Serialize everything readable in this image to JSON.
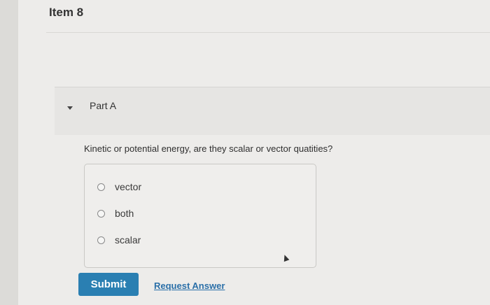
{
  "item": {
    "title": "Item 8"
  },
  "part": {
    "label": "Part A"
  },
  "question": {
    "text": "Kinetic or potential energy, are they scalar or vector quatities?",
    "options": [
      "vector",
      "both",
      "scalar"
    ]
  },
  "actions": {
    "submit_label": "Submit",
    "request_answer_label": "Request Answer"
  },
  "colors": {
    "submit_bg": "#2a7fb2",
    "link": "#2a6fa8"
  }
}
